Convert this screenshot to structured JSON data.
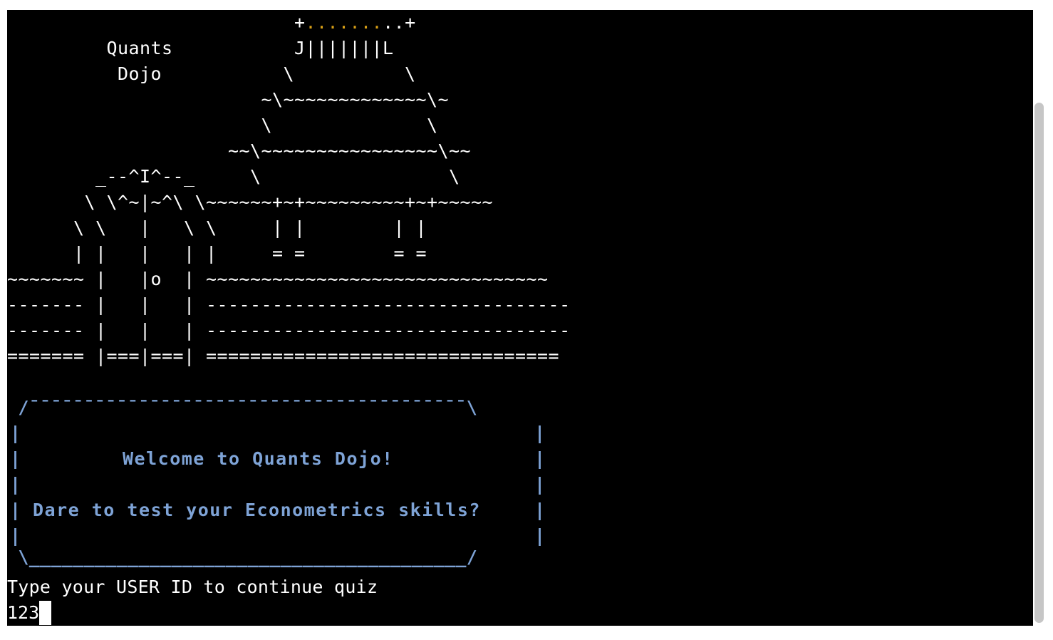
{
  "art": {
    "line0_pre": "                          +",
    "line0_dots": ".......",
    "line0_post": "..+",
    "line1": "         Quants           J|||||||L",
    "line2": "          Dojo           \\          \\",
    "line3": "                       ~\\~~~~~~~~~~~~~\\~",
    "line4": "                       \\              \\",
    "line5": "                    ~~\\~~~~~~~~~~~~~~~~\\~~",
    "line6": "        _--^I^--_     \\                 \\",
    "line7": "       \\ \\^~|~^\\ \\~~~~~~+~+~~~~~~~~~+~+~~~~~",
    "line8": "      \\ \\   |   \\ \\     | |        | |",
    "line9": "      | |   |   | |     = =        = =",
    "line10": "~~~~~~~ |   |o  | ~~~~~~~~~~~~~~~~~~~~~~~~~~~~~~~",
    "line11": "------- |   |   | ---------------------------------",
    "line12": "------- |   |   | ---------------------------------",
    "line13": "======= |===|===| ================================"
  },
  "welcome_box": {
    "top_border": " /¯¯¯¯¯¯¯¯¯¯¯¯¯¯¯¯¯¯¯¯¯¯¯¯¯¯¯¯¯¯¯¯¯¯¯¯¯¯¯¯\\",
    "side_left": "|",
    "side_right": "|",
    "title": "Welcome to Quants Dojo!",
    "subtitle": "Dare to test your Econometrics skills?",
    "bottom_border": " \\________________________________________/"
  },
  "prompt": {
    "text": "Type your USER ID to continue quiz",
    "input_value": "123"
  },
  "colors": {
    "background": "#000000",
    "text": "#ffffff",
    "box_accent": "#7ea3d6",
    "dots_accent": "#d9a017"
  }
}
